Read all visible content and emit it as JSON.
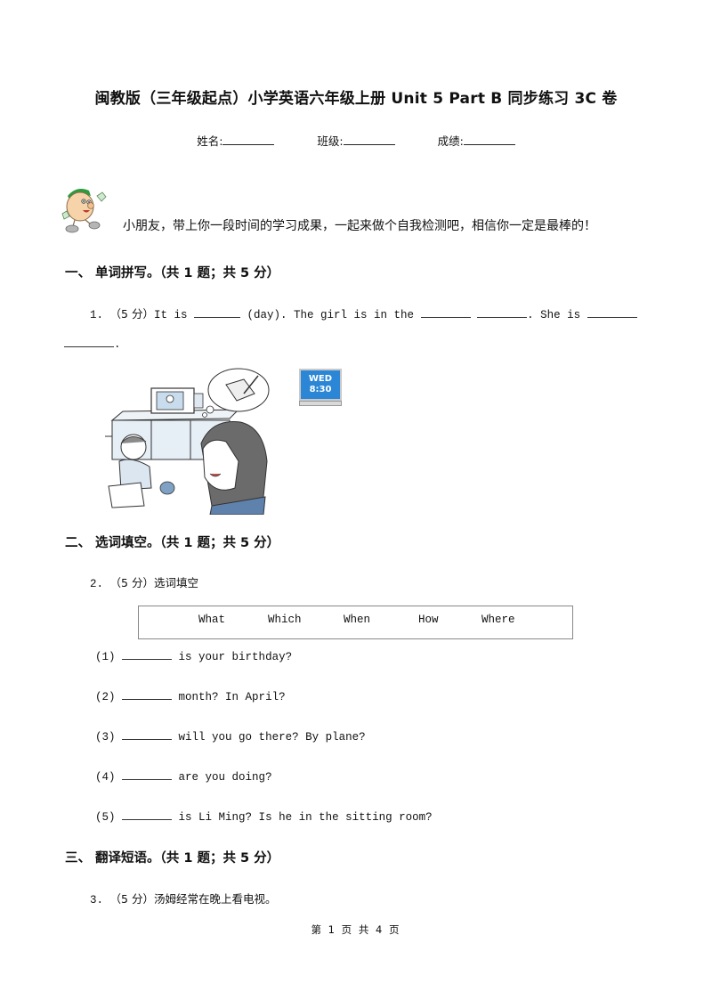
{
  "header": {
    "title": "闽教版（三年级起点）小学英语六年级上册 Unit 5 Part B 同步练习 3C 卷",
    "fields": [
      {
        "label": "姓名:"
      },
      {
        "label": "班级:"
      },
      {
        "label": "成绩:"
      }
    ]
  },
  "intro": {
    "mascot_icon": "cartoon-mascot-icon",
    "text": "小朋友，带上你一段时间的学习成果，一起来做个自我检测吧，相信你一定是最棒的！"
  },
  "sections": [
    {
      "heading": "一、  单词拼写。（共 1 题；共 5 分）",
      "questions": [
        {
          "number": "1.",
          "score": "（5 分）",
          "parts": [
            "It is",
            "(day). The girl is in the",
            ".",
            "She is",
            "."
          ],
          "image": {
            "description": "girl watching TV in living room, woman thinking of homework",
            "clock_day": "WED",
            "clock_time": "8:30"
          }
        }
      ]
    },
    {
      "heading": "二、  选词填空。（共 1 题；共 5 分）",
      "questions": [
        {
          "number": "2.",
          "score": "（5 分）",
          "prompt": "选词填空",
          "word_bank": [
            "What",
            "Which",
            "When",
            "How",
            "Where"
          ],
          "items": [
            {
              "label": "(1)",
              "text": "is your birthday?"
            },
            {
              "label": "(2)",
              "text": "month? In April?"
            },
            {
              "label": "(3)",
              "text": "will you go there? By plane?"
            },
            {
              "label": "(4)",
              "text": "are you doing?"
            },
            {
              "label": "(5)",
              "text": "is Li Ming? Is he in the sitting room?"
            }
          ]
        }
      ]
    },
    {
      "heading": "三、  翻译短语。（共 1 题；共 5 分）",
      "questions": [
        {
          "number": "3.",
          "score": "（5 分）",
          "prompt": "汤姆经常在晚上看电视。"
        }
      ]
    }
  ],
  "footer": {
    "page_text": "第 1 页 共 4 页"
  }
}
